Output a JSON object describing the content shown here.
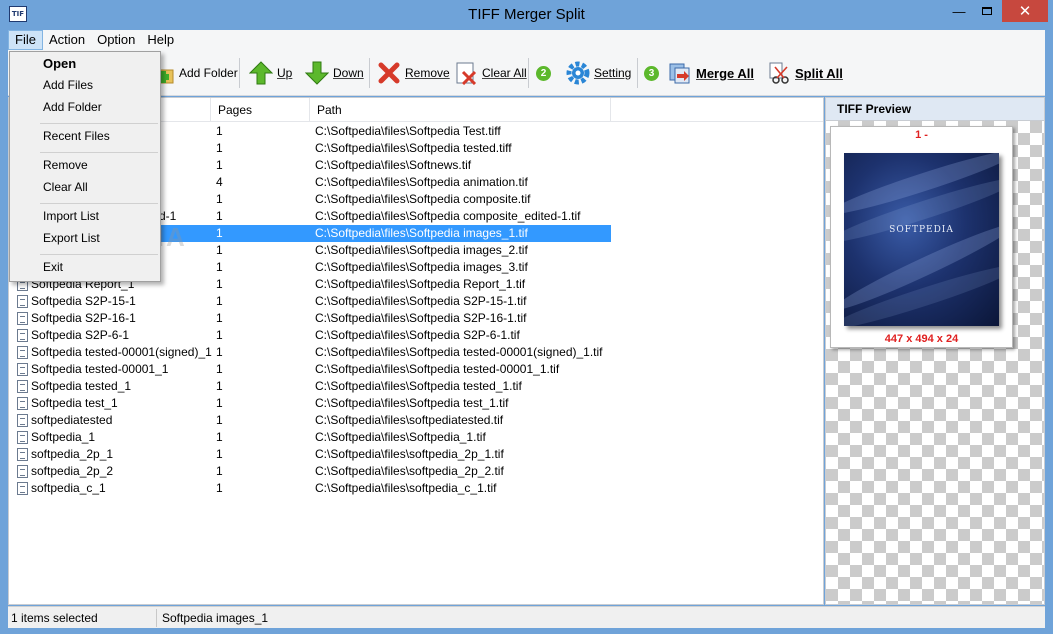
{
  "window": {
    "title": "TIFF Merger Split",
    "icon_text": "TIF"
  },
  "menu": {
    "file": "File",
    "action": "Action",
    "option": "Option",
    "help": "Help"
  },
  "file_menu": {
    "open": "Open",
    "add_files": "Add Files",
    "add_folder": "Add Folder",
    "recent_files": "Recent Files",
    "remove": "Remove",
    "clear_all": "Clear All",
    "import_list": "Import List",
    "export_list": "Export List",
    "exit": "Exit"
  },
  "toolbar": {
    "add_folder": "Add Folder",
    "up": "Up",
    "down": "Down",
    "remove": "Remove",
    "clear_all": "Clear All",
    "step2": "2",
    "setting": "Setting",
    "step3": "3",
    "merge_all": "Merge All",
    "split_all": "Split All"
  },
  "list": {
    "columns": {
      "pages": "Pages",
      "path": "Path"
    },
    "rows": [
      {
        "name": "",
        "pages": "1",
        "path": "C:\\Softpedia\\files\\Softpedia Test.tiff"
      },
      {
        "name": "",
        "pages": "1",
        "path": "C:\\Softpedia\\files\\Softpedia tested.tiff"
      },
      {
        "name": "",
        "pages": "1",
        "path": "C:\\Softpedia\\files\\Softnews.tif"
      },
      {
        "name": "",
        "pages": "4",
        "path": "C:\\Softpedia\\files\\Softpedia animation.tif"
      },
      {
        "name": "",
        "pages": "1",
        "path": "C:\\Softpedia\\files\\Softpedia composite.tif"
      },
      {
        "name": "d-1",
        "pages": "1",
        "path": "C:\\Softpedia\\files\\Softpedia composite_edited-1.tif"
      },
      {
        "name": "",
        "pages": "1",
        "path": "C:\\Softpedia\\files\\Softpedia images_1.tif",
        "selected": true
      },
      {
        "name": "",
        "pages": "1",
        "path": "C:\\Softpedia\\files\\Softpedia images_2.tif"
      },
      {
        "name": "",
        "pages": "1",
        "path": "C:\\Softpedia\\files\\Softpedia images_3.tif"
      },
      {
        "name": "Softpedia Report_1",
        "pages": "1",
        "path": "C:\\Softpedia\\files\\Softpedia Report_1.tif"
      },
      {
        "name": "Softpedia S2P-15-1",
        "pages": "1",
        "path": "C:\\Softpedia\\files\\Softpedia S2P-15-1.tif"
      },
      {
        "name": "Softpedia S2P-16-1",
        "pages": "1",
        "path": "C:\\Softpedia\\files\\Softpedia S2P-16-1.tif"
      },
      {
        "name": "Softpedia S2P-6-1",
        "pages": "1",
        "path": "C:\\Softpedia\\files\\Softpedia S2P-6-1.tif"
      },
      {
        "name": "Softpedia tested-00001(signed)_1",
        "pages": "1",
        "path": "C:\\Softpedia\\files\\Softpedia tested-00001(signed)_1.tif"
      },
      {
        "name": "Softpedia tested-00001_1",
        "pages": "1",
        "path": "C:\\Softpedia\\files\\Softpedia tested-00001_1.tif"
      },
      {
        "name": "Softpedia tested_1",
        "pages": "1",
        "path": "C:\\Softpedia\\files\\Softpedia tested_1.tif"
      },
      {
        "name": "Softpedia test_1",
        "pages": "1",
        "path": "C:\\Softpedia\\files\\Softpedia test_1.tif"
      },
      {
        "name": "softpediatested",
        "pages": "1",
        "path": "C:\\Softpedia\\files\\softpediatested.tif"
      },
      {
        "name": "Softpedia_1",
        "pages": "1",
        "path": "C:\\Softpedia\\files\\Softpedia_1.tif"
      },
      {
        "name": "softpedia_2p_1",
        "pages": "1",
        "path": "C:\\Softpedia\\files\\softpedia_2p_1.tif"
      },
      {
        "name": "softpedia_2p_2",
        "pages": "1",
        "path": "C:\\Softpedia\\files\\softpedia_2p_2.tif"
      },
      {
        "name": "softpedia_c_1",
        "pages": "1",
        "path": "C:\\Softpedia\\files\\softpedia_c_1.tif"
      }
    ]
  },
  "preview": {
    "header": "TIFF Preview",
    "page_label": "1 -",
    "image_brand": "SOFTPEDIA",
    "dimensions": "447 x 494 x 24"
  },
  "status": {
    "selection": "1 items selected",
    "current_file": "Softpedia images_1"
  },
  "colors": {
    "title_bar": "#6fa3d9",
    "selection": "#3399ff",
    "close_button": "#c7483e",
    "dims_text": "#e02020"
  },
  "watermark": "SOFTPEDIA"
}
